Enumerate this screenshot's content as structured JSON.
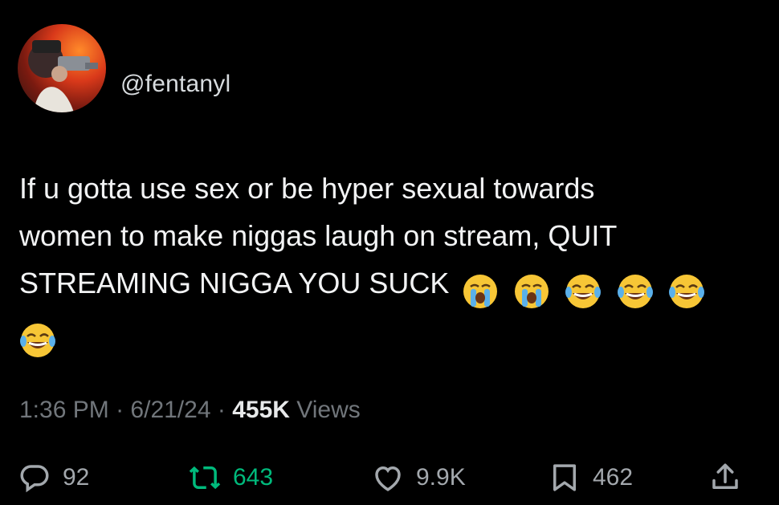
{
  "post": {
    "author_handle": "@fentanyl",
    "text_line1": "If u gotta use sex or be hyper sexual towards",
    "text_line2": "women to make niggas laugh on stream, QUIT",
    "text_line3": "STREAMING NIGGA YOU SUCK",
    "emojis": [
      "loudly-crying-face",
      "loudly-crying-face",
      "face-with-tears-of-joy",
      "face-with-tears-of-joy",
      "face-with-tears-of-joy",
      "face-with-tears-of-joy"
    ],
    "time": "1:36 PM",
    "date": "6/21/24",
    "separator": "·",
    "views_count": "455K",
    "views_label": "Views"
  },
  "actions": {
    "replies": "92",
    "reposts": "643",
    "likes": "9.9K",
    "bookmarks": "462"
  },
  "colors": {
    "background": "#000000",
    "text": "#e7e9ea",
    "muted": "#71767b",
    "repost_active": "#00ba7c"
  }
}
